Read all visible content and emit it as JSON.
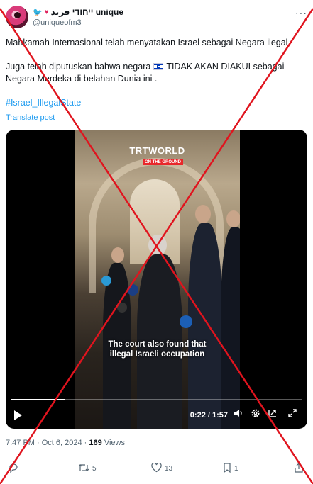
{
  "author": {
    "display_name": "ייחודי فريد unique",
    "handle": "@uniqueofm3",
    "name_icons": [
      "twitter-bird-icon",
      "heart-icon",
      "clover-icon"
    ]
  },
  "tweet": {
    "line1": "Mahkamah Internasional telah menyatakan Israel sebagai Negara ilegal.",
    "line2_a": "Juga telah diputuskan bahwa negara",
    "line2_b": "TIDAK AKAN DIAKUI  sebagai Negara Merdeka di belahan Dunia ini .",
    "hashtag": "#Israel_IllegalState",
    "translate": "Translate post"
  },
  "video": {
    "channel_logo": "TRTWORLD",
    "channel_sub": "ON THE GROUND",
    "caption_line1": "The court also found that",
    "caption_line2": "illegal Israeli occupation",
    "time": "0:22 / 1:57",
    "progress": 0.187
  },
  "meta": {
    "time": "7:47 PM",
    "separator1": " · ",
    "date": "Oct 6, 2024",
    "separator2": " · ",
    "views": "169",
    "views_label": " Views"
  },
  "actions": {
    "retweets": "5",
    "likes": "13",
    "bookmarks": "1"
  },
  "colors": {
    "accent": "#1d9bf0",
    "overlay_x": "#e0141e"
  }
}
